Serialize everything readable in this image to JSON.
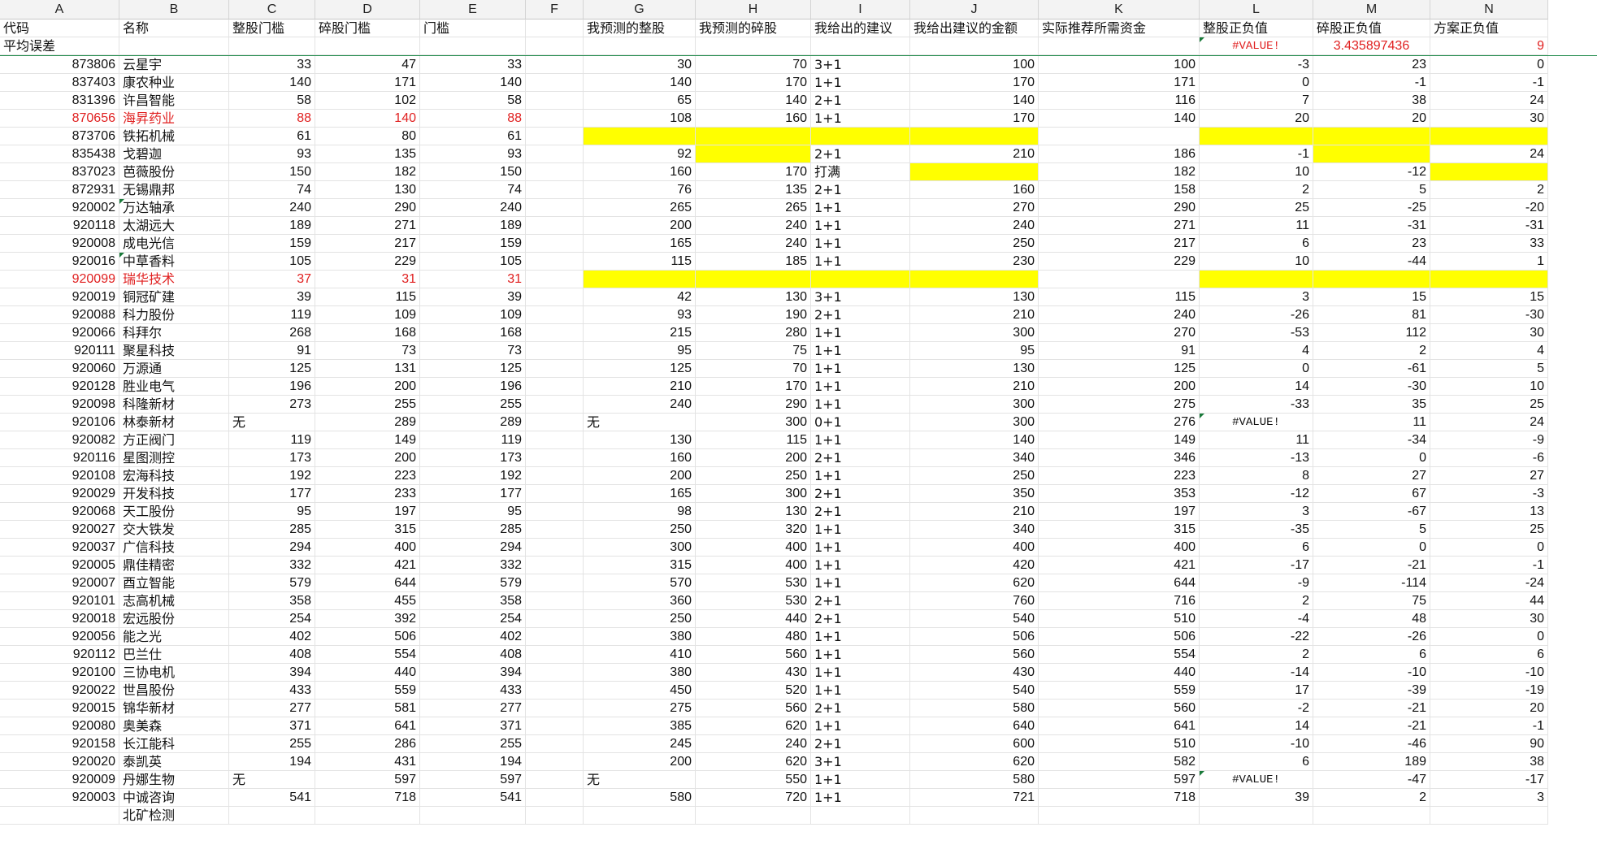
{
  "columns": [
    "A",
    "B",
    "C",
    "D",
    "E",
    "F",
    "G",
    "H",
    "I",
    "J",
    "K",
    "L",
    "M",
    "N"
  ],
  "headers": [
    "代码",
    "名称",
    "整股门槛",
    "碎股门槛",
    "门槛",
    "",
    "我预测的整股",
    "我预测的碎股",
    "我给出的建议",
    "我给出建议的金额",
    "实际推荐所需资金",
    "整股正负值",
    "碎股正负值",
    "方案正负值"
  ],
  "summary": {
    "label": "平均误差",
    "L": "#VALUE!",
    "M": "3.435897436",
    "N": "9"
  },
  "rows": [
    {
      "A": "873806",
      "B": "云星宇",
      "C": "33",
      "D": "47",
      "E": "33",
      "G": "30",
      "H": "70",
      "I": "3+1",
      "J": "100",
      "K": "100",
      "L": "-3",
      "M": "23",
      "N": "0"
    },
    {
      "A": "837403",
      "B": "康农种业",
      "C": "140",
      "D": "171",
      "E": "140",
      "G": "140",
      "H": "170",
      "I": "1+1",
      "J": "170",
      "K": "171",
      "L": "0",
      "M": "-1",
      "N": "-1"
    },
    {
      "A": "831396",
      "B": "许昌智能",
      "C": "58",
      "D": "102",
      "E": "58",
      "G": "65",
      "H": "140",
      "I": "2+1",
      "J": "140",
      "K": "116",
      "L": "7",
      "M": "38",
      "N": "24"
    },
    {
      "A": "870656",
      "B": "海昇药业",
      "C": "88",
      "D": "140",
      "E": "88",
      "G": "108",
      "H": "160",
      "I": "1+1",
      "J": "170",
      "K": "140",
      "L": "20",
      "M": "20",
      "N": "30",
      "red": true
    },
    {
      "A": "873706",
      "B": "铁拓机械",
      "C": "61",
      "D": "80",
      "E": "61",
      "G": "",
      "H": "",
      "I": "",
      "J": "",
      "K": "",
      "L": "",
      "M": "",
      "N": "",
      "yellow": [
        "G",
        "H",
        "I",
        "J",
        "L",
        "M",
        "N"
      ]
    },
    {
      "A": "835438",
      "B": "戈碧迦",
      "C": "93",
      "D": "135",
      "E": "93",
      "G": "92",
      "H": "",
      "I": "2+1",
      "J": "210",
      "K": "186",
      "L": "-1",
      "M": "",
      "N": "24",
      "yellow": [
        "H",
        "M"
      ]
    },
    {
      "A": "837023",
      "B": "芭薇股份",
      "C": "150",
      "D": "182",
      "E": "150",
      "G": "160",
      "H": "170",
      "I": "打满",
      "J": "",
      "K": "182",
      "L": "10",
      "M": "-12",
      "N": "",
      "yellow": [
        "J",
        "N"
      ]
    },
    {
      "A": "872931",
      "B": "无锡鼎邦",
      "C": "74",
      "D": "130",
      "E": "74",
      "G": "76",
      "H": "135",
      "I": "2+1",
      "J": "160",
      "K": "158",
      "L": "2",
      "M": "5",
      "N": "2"
    },
    {
      "A": "920002",
      "B": "万达轴承",
      "C": "240",
      "D": "290",
      "E": "240",
      "G": "265",
      "H": "265",
      "I": "1+1",
      "J": "270",
      "K": "290",
      "L": "25",
      "M": "-25",
      "N": "-20",
      "triB": true
    },
    {
      "A": "920118",
      "B": "太湖远大",
      "C": "189",
      "D": "271",
      "E": "189",
      "G": "200",
      "H": "240",
      "I": "1+1",
      "J": "240",
      "K": "271",
      "L": "11",
      "M": "-31",
      "N": "-31"
    },
    {
      "A": "920008",
      "B": "成电光信",
      "C": "159",
      "D": "217",
      "E": "159",
      "G": "165",
      "H": "240",
      "I": "1+1",
      "J": "250",
      "K": "217",
      "L": "6",
      "M": "23",
      "N": "33"
    },
    {
      "A": "920016",
      "B": "中草香料",
      "C": "105",
      "D": "229",
      "E": "105",
      "G": "115",
      "H": "185",
      "I": "1+1",
      "J": "230",
      "K": "229",
      "L": "10",
      "M": "-44",
      "N": "1",
      "triB": true
    },
    {
      "A": "920099",
      "B": "瑞华技术",
      "C": "37",
      "D": "31",
      "E": "31",
      "G": "",
      "H": "",
      "I": "",
      "J": "",
      "K": "",
      "L": "",
      "M": "",
      "N": "",
      "red": true,
      "yellow": [
        "G",
        "H",
        "I",
        "J",
        "L",
        "M",
        "N"
      ]
    },
    {
      "A": "920019",
      "B": "铜冠矿建",
      "C": "39",
      "D": "115",
      "E": "39",
      "G": "42",
      "H": "130",
      "I": "3+1",
      "J": "130",
      "K": "115",
      "L": "3",
      "M": "15",
      "N": "15"
    },
    {
      "A": "920088",
      "B": "科力股份",
      "C": "119",
      "D": "109",
      "E": "109",
      "G": "93",
      "H": "190",
      "I": "2+1",
      "J": "210",
      "K": "240",
      "L": "-26",
      "M": "81",
      "N": "-30"
    },
    {
      "A": "920066",
      "B": "科拜尔",
      "C": "268",
      "D": "168",
      "E": "168",
      "G": "215",
      "H": "280",
      "I": "1+1",
      "J": "300",
      "K": "270",
      "L": "-53",
      "M": "112",
      "N": "30"
    },
    {
      "A": "920111",
      "B": "聚星科技",
      "C": "91",
      "D": "73",
      "E": "73",
      "G": "95",
      "H": "75",
      "I": "1+1",
      "J": "95",
      "K": "91",
      "L": "4",
      "M": "2",
      "N": "4"
    },
    {
      "A": "920060",
      "B": "万源通",
      "C": "125",
      "D": "131",
      "E": "125",
      "G": "125",
      "H": "70",
      "I": "1+1",
      "J": "130",
      "K": "125",
      "L": "0",
      "M": "-61",
      "N": "5"
    },
    {
      "A": "920128",
      "B": "胜业电气",
      "C": "196",
      "D": "200",
      "E": "196",
      "G": "210",
      "H": "170",
      "I": "1+1",
      "J": "210",
      "K": "200",
      "L": "14",
      "M": "-30",
      "N": "10"
    },
    {
      "A": "920098",
      "B": "科隆新材",
      "C": "273",
      "D": "255",
      "E": "255",
      "G": "240",
      "H": "290",
      "I": "1+1",
      "J": "300",
      "K": "275",
      "L": "-33",
      "M": "35",
      "N": "25"
    },
    {
      "A": "920106",
      "B": "林泰新材",
      "C": "无",
      "D": "289",
      "E": "289",
      "G": "无",
      "H": "300",
      "I": "0+1",
      "J": "300",
      "K": "276",
      "L": "#VALUE!",
      "M": "11",
      "N": "24",
      "triL": true
    },
    {
      "A": "920082",
      "B": "方正阀门",
      "C": "119",
      "D": "149",
      "E": "119",
      "G": "130",
      "H": "115",
      "I": "1+1",
      "J": "140",
      "K": "149",
      "L": "11",
      "M": "-34",
      "N": "-9"
    },
    {
      "A": "920116",
      "B": "星图测控",
      "C": "173",
      "D": "200",
      "E": "173",
      "G": "160",
      "H": "200",
      "I": "2+1",
      "J": "340",
      "K": "346",
      "L": "-13",
      "M": "0",
      "N": "-6"
    },
    {
      "A": "920108",
      "B": "宏海科技",
      "C": "192",
      "D": "223",
      "E": "192",
      "G": "200",
      "H": "250",
      "I": "1+1",
      "J": "250",
      "K": "223",
      "L": "8",
      "M": "27",
      "N": "27"
    },
    {
      "A": "920029",
      "B": "开发科技",
      "C": "177",
      "D": "233",
      "E": "177",
      "G": "165",
      "H": "300",
      "I": "2+1",
      "J": "350",
      "K": "353",
      "L": "-12",
      "M": "67",
      "N": "-3"
    },
    {
      "A": "920068",
      "B": "天工股份",
      "C": "95",
      "D": "197",
      "E": "95",
      "G": "98",
      "H": "130",
      "I": "2+1",
      "J": "210",
      "K": "197",
      "L": "3",
      "M": "-67",
      "N": "13"
    },
    {
      "A": "920027",
      "B": "交大铁发",
      "C": "285",
      "D": "315",
      "E": "285",
      "G": "250",
      "H": "320",
      "I": "1+1",
      "J": "340",
      "K": "315",
      "L": "-35",
      "M": "5",
      "N": "25"
    },
    {
      "A": "920037",
      "B": "广信科技",
      "C": "294",
      "D": "400",
      "E": "294",
      "G": "300",
      "H": "400",
      "I": "1+1",
      "J": "400",
      "K": "400",
      "L": "6",
      "M": "0",
      "N": "0"
    },
    {
      "A": "920005",
      "B": "鼎佳精密",
      "C": "332",
      "D": "421",
      "E": "332",
      "G": "315",
      "H": "400",
      "I": "1+1",
      "J": "420",
      "K": "421",
      "L": "-17",
      "M": "-21",
      "N": "-1"
    },
    {
      "A": "920007",
      "B": "酉立智能",
      "C": "579",
      "D": "644",
      "E": "579",
      "G": "570",
      "H": "530",
      "I": "1+1",
      "J": "620",
      "K": "644",
      "L": "-9",
      "M": "-114",
      "N": "-24"
    },
    {
      "A": "920101",
      "B": "志高机械",
      "C": "358",
      "D": "455",
      "E": "358",
      "G": "360",
      "H": "530",
      "I": "2+1",
      "J": "760",
      "K": "716",
      "L": "2",
      "M": "75",
      "N": "44"
    },
    {
      "A": "920018",
      "B": "宏远股份",
      "C": "254",
      "D": "392",
      "E": "254",
      "G": "250",
      "H": "440",
      "I": "2+1",
      "J": "540",
      "K": "510",
      "L": "-4",
      "M": "48",
      "N": "30"
    },
    {
      "A": "920056",
      "B": "能之光",
      "C": "402",
      "D": "506",
      "E": "402",
      "G": "380",
      "H": "480",
      "I": "1+1",
      "J": "506",
      "K": "506",
      "L": "-22",
      "M": "-26",
      "N": "0"
    },
    {
      "A": "920112",
      "B": "巴兰仕",
      "C": "408",
      "D": "554",
      "E": "408",
      "G": "410",
      "H": "560",
      "I": "1+1",
      "J": "560",
      "K": "554",
      "L": "2",
      "M": "6",
      "N": "6"
    },
    {
      "A": "920100",
      "B": "三协电机",
      "C": "394",
      "D": "440",
      "E": "394",
      "G": "380",
      "H": "430",
      "I": "1+1",
      "J": "430",
      "K": "440",
      "L": "-14",
      "M": "-10",
      "N": "-10"
    },
    {
      "A": "920022",
      "B": "世昌股份",
      "C": "433",
      "D": "559",
      "E": "433",
      "G": "450",
      "H": "520",
      "I": "1+1",
      "J": "540",
      "K": "559",
      "L": "17",
      "M": "-39",
      "N": "-19"
    },
    {
      "A": "920015",
      "B": "锦华新材",
      "C": "277",
      "D": "581",
      "E": "277",
      "G": "275",
      "H": "560",
      "I": "2+1",
      "J": "580",
      "K": "560",
      "L": "-2",
      "M": "-21",
      "N": "20"
    },
    {
      "A": "920080",
      "B": "奥美森",
      "C": "371",
      "D": "641",
      "E": "371",
      "G": "385",
      "H": "620",
      "I": "1+1",
      "J": "640",
      "K": "641",
      "L": "14",
      "M": "-21",
      "N": "-1"
    },
    {
      "A": "920158",
      "B": "长江能科",
      "C": "255",
      "D": "286",
      "E": "255",
      "G": "245",
      "H": "240",
      "I": "2+1",
      "J": "600",
      "K": "510",
      "L": "-10",
      "M": "-46",
      "N": "90"
    },
    {
      "A": "920020",
      "B": "泰凯英",
      "C": "194",
      "D": "431",
      "E": "194",
      "G": "200",
      "H": "620",
      "I": "3+1",
      "J": "620",
      "K": "582",
      "L": "6",
      "M": "189",
      "N": "38"
    },
    {
      "A": "920009",
      "B": "丹娜生物",
      "C": "无",
      "D": "597",
      "E": "597",
      "G": "无",
      "H": "550",
      "I": "1+1",
      "J": "580",
      "K": "597",
      "L": "#VALUE!",
      "M": "-47",
      "N": "-17",
      "triL": true
    },
    {
      "A": "920003",
      "B": "中诚咨询",
      "C": "541",
      "D": "718",
      "E": "541",
      "G": "580",
      "H": "720",
      "I": "1+1",
      "J": "721",
      "K": "718",
      "L": "39",
      "M": "2",
      "N": "3"
    },
    {
      "A": "",
      "B": "北矿检测",
      "C": "",
      "D": "",
      "E": "",
      "G": "",
      "H": "",
      "I": "",
      "J": "",
      "K": "",
      "L": "",
      "M": "",
      "N": ""
    }
  ]
}
